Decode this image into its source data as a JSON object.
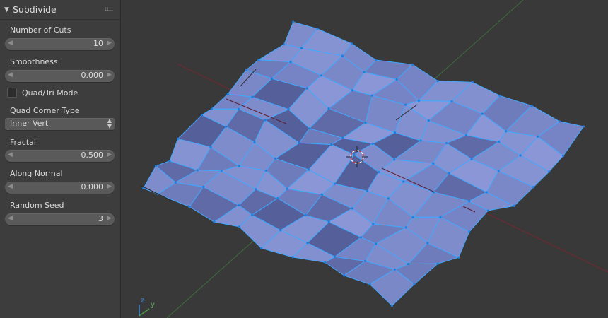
{
  "panel": {
    "title": "Subdivide",
    "number_of_cuts": {
      "label": "Number of Cuts",
      "value": "10"
    },
    "smoothness": {
      "label": "Smoothness",
      "value": "0.000"
    },
    "quad_tri_mode": {
      "label": "Quad/Tri Mode",
      "checked": false
    },
    "quad_corner_type": {
      "label": "Quad Corner Type",
      "value": "Inner Vert"
    },
    "fractal": {
      "label": "Fractal",
      "value": "0.500"
    },
    "along_normal": {
      "label": "Along Normal",
      "value": "0.000"
    },
    "random_seed": {
      "label": "Random Seed",
      "value": "3"
    }
  },
  "icons": {
    "collapse": "triangle-down-icon",
    "grip": "drag-grip-icon",
    "decrement": "arrow-left-icon",
    "increment": "arrow-right-icon",
    "dropdown": "updown-icon",
    "cursor": "3d-cursor-icon"
  },
  "axis_gizmo": {
    "z": "z",
    "y": "y"
  },
  "colors": {
    "viewport_bg": "#393939",
    "panel_bg": "#3d3d3d",
    "mesh_face": "#7f8ccc",
    "mesh_edge": "#40a8ff",
    "x_axis": "#8a2a3a",
    "y_axis": "#3e6e3e"
  }
}
